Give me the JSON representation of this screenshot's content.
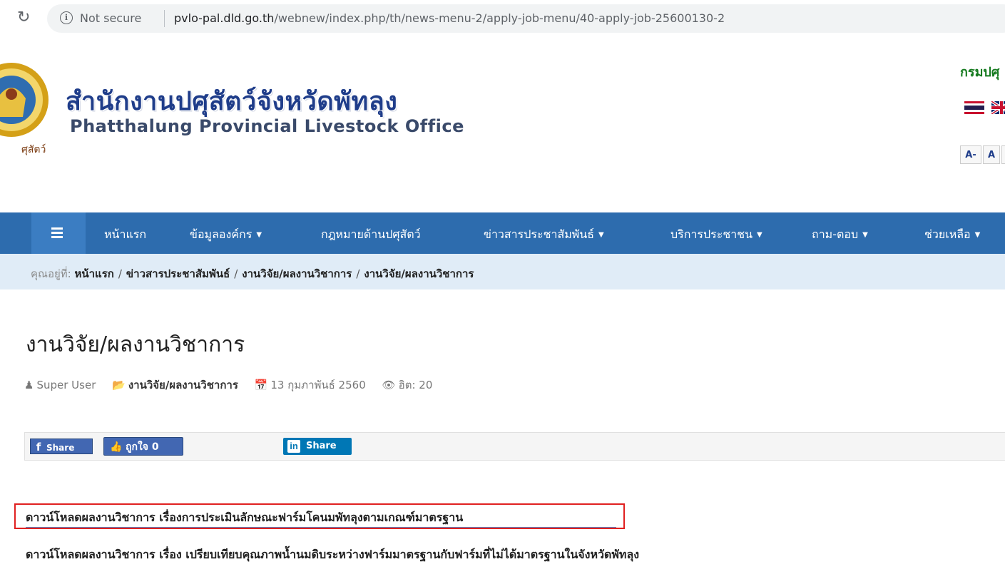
{
  "browser": {
    "security": "Not secure",
    "url_host": "pvlo-pal.dld.go.th",
    "url_path": "/webnew/index.php/th/news-menu-2/apply-job-menu/40-apply-job-25600130-2"
  },
  "header": {
    "site_title_th": "สำนักงานปศุสัตว์จังหวัดพัทลุง",
    "site_title_en": "Phatthalung Provincial Livestock Office",
    "seal_text": "ศุสัตว์",
    "dept_text": "กรมปศุ",
    "font_buttons": [
      "A-",
      "A",
      ""
    ]
  },
  "nav": {
    "items": [
      {
        "label": "หน้าแรก",
        "dropdown": false
      },
      {
        "label": "ข้อมูลองค์กร",
        "dropdown": true
      },
      {
        "label": "กฎหมายด้านปศุสัตว์",
        "dropdown": false
      },
      {
        "label": "ข่าวสารประชาสัมพันธ์",
        "dropdown": true
      },
      {
        "label": "บริการประชาชน",
        "dropdown": true
      },
      {
        "label": "ถาม-ตอบ",
        "dropdown": true
      },
      {
        "label": "ช่วยเหลือ",
        "dropdown": true
      }
    ]
  },
  "breadcrumb": {
    "label": "คุณอยู่ที่:",
    "items": [
      "หน้าแรก",
      "ข่าวสารประชาสัมพันธ์",
      "งานวิจัย/ผลงานวิชาการ"
    ],
    "current": "งานวิจัย/ผลงานวิชาการ"
  },
  "article": {
    "title": "งานวิจัย/ผลงานวิชาการ",
    "author": "Super User",
    "category": "งานวิจัย/ผลงานวิชาการ",
    "date": "13 กุมภาพันธ์ 2560",
    "hits": "ฮิต: 20"
  },
  "share": {
    "facebook": "Share",
    "like": "ถูกใจ 0",
    "linkedin": "Share"
  },
  "downloads": [
    "ดาวน์โหลดผลงานวิชาการ เรื่องการประเมินลักษณะฟาร์มโคนมพัทลุงตามเกณฑ์มาตรฐาน",
    "ดาวน์โหลดผลงานวิชาการ เรื่อง เปรียบเทียบคุณภาพน้ำนมดิบระหว่างฟาร์มมาตรฐานกับฟาร์มที่ไม่ได้มาตรฐานในจังหวัดพัทลุง"
  ],
  "colors": {
    "nav_bg": "#2d6cae",
    "breadcrumb_bg": "#e0ecf7",
    "site_title": "#1f3d8a",
    "dept": "#157a1f",
    "highlight_box": "#e02020"
  }
}
